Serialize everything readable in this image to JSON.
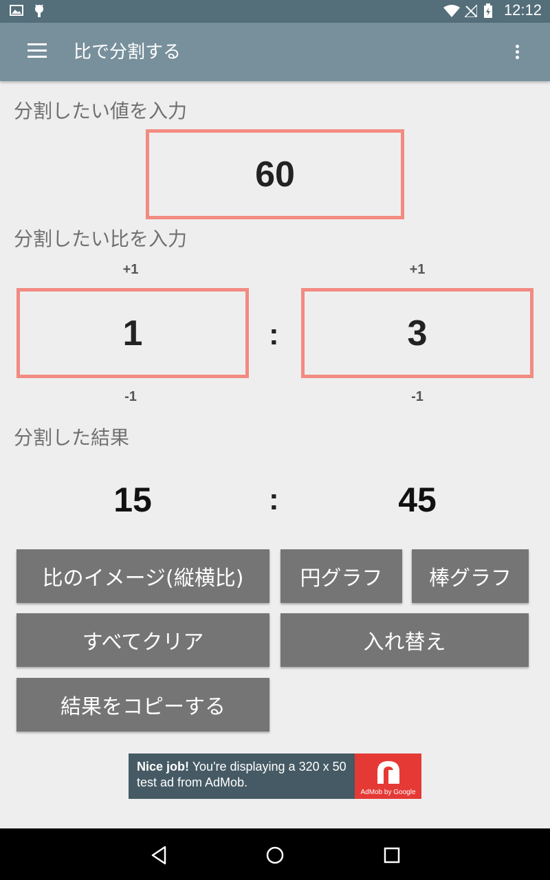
{
  "status_bar": {
    "time": "12:12"
  },
  "app_bar": {
    "title": "比で分割する"
  },
  "value_section": {
    "label": "分割したい値を入力",
    "value": "60"
  },
  "ratio_section": {
    "label": "分割したい比を入力",
    "left": {
      "plus": "+1",
      "value": "1",
      "minus": "-1"
    },
    "separator": ":",
    "right": {
      "plus": "+1",
      "value": "3",
      "minus": "-1"
    }
  },
  "result_section": {
    "label": "分割した結果",
    "left": "15",
    "separator": ":",
    "right": "45"
  },
  "buttons": {
    "ratio_image": "比のイメージ(縦横比)",
    "pie_chart": "円グラフ",
    "bar_chart": "棒グラフ",
    "clear_all": "すべてクリア",
    "swap": "入れ替え",
    "copy_result": "結果をコピーする"
  },
  "ad": {
    "bold": "Nice job!",
    "text": " You're displaying a 320 x 50 test ad from AdMob.",
    "brand": "AdMob by Google"
  },
  "colors": {
    "status_bar": "#546e7a",
    "app_bar": "#78909c",
    "input_border": "#f28b82",
    "button": "#757575",
    "ad_accent": "#e53935"
  }
}
